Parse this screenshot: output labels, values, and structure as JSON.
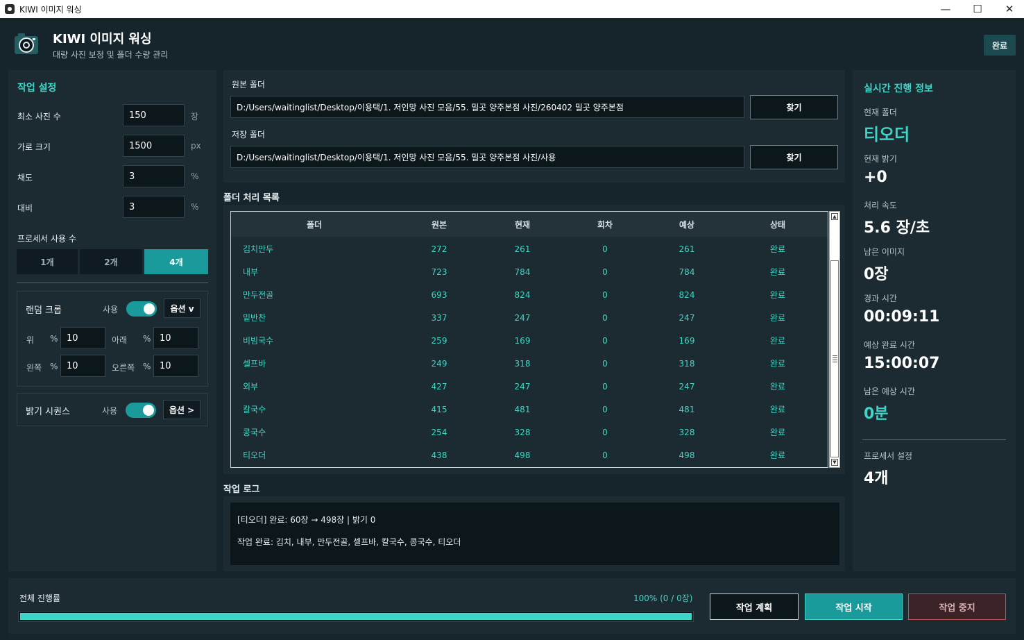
{
  "window": {
    "title": "KIWI 이미지 워싱",
    "controls": {
      "minimize": "—",
      "maximize": "☐",
      "close": "✕"
    }
  },
  "header": {
    "title": "KIWI 이미지 워싱",
    "subtitle": "대량 사진 보정 및 폴더 수량 관리",
    "status": "완료"
  },
  "settings": {
    "title": "작업 설정",
    "min_photos": {
      "label": "최소 사진 수",
      "value": "150",
      "unit": "장"
    },
    "width": {
      "label": "가로 크기",
      "value": "1500",
      "unit": "px"
    },
    "saturation": {
      "label": "채도",
      "value": "3",
      "unit": "%"
    },
    "contrast": {
      "label": "대비",
      "value": "3",
      "unit": "%"
    },
    "processors": {
      "label": "프로세서 사용 수",
      "options": [
        "1개",
        "2개",
        "4개"
      ],
      "selected": "4개"
    },
    "random_crop": {
      "label": "랜덤 크롭",
      "use_label": "사용",
      "enabled": true,
      "option_label": "옵션 v",
      "top": {
        "label": "위",
        "unit": "%",
        "value": "10"
      },
      "bottom": {
        "label": "아래",
        "unit": "%",
        "value": "10"
      },
      "left": {
        "label": "왼쪽",
        "unit": "%",
        "value": "10"
      },
      "right": {
        "label": "오른쪽",
        "unit": "%",
        "value": "10"
      }
    },
    "brightness_sequence": {
      "label": "밝기 시퀀스",
      "use_label": "사용",
      "enabled": true,
      "option_label": "옵션 >"
    }
  },
  "folders": {
    "source": {
      "label": "원본 폴더",
      "value": "D:/Users/waitinglist/Desktop/이용택/1. 저인망 사진 모음/55. 밀곳 양주본점 사진/260402 밀곳 양주본점",
      "button": "찾기"
    },
    "output": {
      "label": "저장 폴더",
      "value": "D:/Users/waitinglist/Desktop/이용택/1. 저인망 사진 모음/55. 밀곳 양주본점 사진/사용",
      "button": "찾기"
    }
  },
  "folder_list": {
    "title": "폴더 처리 목록",
    "columns": [
      "폴더",
      "원본",
      "현재",
      "회차",
      "예상",
      "상태"
    ],
    "rows": [
      {
        "folder": "김치만두",
        "original": "272",
        "current": "261",
        "round": "0",
        "expected": "261",
        "status": "완료"
      },
      {
        "folder": "내부",
        "original": "723",
        "current": "784",
        "round": "0",
        "expected": "784",
        "status": "완료"
      },
      {
        "folder": "만두전골",
        "original": "693",
        "current": "824",
        "round": "0",
        "expected": "824",
        "status": "완료"
      },
      {
        "folder": "밑반찬",
        "original": "337",
        "current": "247",
        "round": "0",
        "expected": "247",
        "status": "완료"
      },
      {
        "folder": "비빔국수",
        "original": "259",
        "current": "169",
        "round": "0",
        "expected": "169",
        "status": "완료"
      },
      {
        "folder": "셀프바",
        "original": "249",
        "current": "318",
        "round": "0",
        "expected": "318",
        "status": "완료"
      },
      {
        "folder": "외부",
        "original": "427",
        "current": "247",
        "round": "0",
        "expected": "247",
        "status": "완료"
      },
      {
        "folder": "칼국수",
        "original": "415",
        "current": "481",
        "round": "0",
        "expected": "481",
        "status": "완료"
      },
      {
        "folder": "콩국수",
        "original": "254",
        "current": "328",
        "round": "0",
        "expected": "328",
        "status": "완료"
      },
      {
        "folder": "티오더",
        "original": "438",
        "current": "498",
        "round": "0",
        "expected": "498",
        "status": "완료"
      }
    ]
  },
  "log": {
    "title": "작업 로그",
    "lines": [
      "[티오더] 완료: 60장 → 498장 | 밝기 0",
      "",
      "작업 완료: 김치, 내부, 만두전골, 셀프바, 칼국수, 콩국수, 티오더"
    ]
  },
  "live_info": {
    "title": "실시간 진행 정보",
    "current_folder": {
      "label": "현재 폴더",
      "value": "티오더"
    },
    "current_brightness": {
      "label": "현재 밝기",
      "value": "+0"
    },
    "speed": {
      "label": "처리 속도",
      "value": "5.6 장/초"
    },
    "remaining_images": {
      "label": "남은 이미지",
      "value": "0장"
    },
    "elapsed": {
      "label": "경과 시간",
      "value": "00:09:11"
    },
    "eta": {
      "label": "예상 완료 시간",
      "value": "15:00:07"
    },
    "remaining_time": {
      "label": "남은 예상 시간",
      "value": "0분"
    },
    "processor_setting": {
      "label": "프로세서 설정",
      "value": "4개"
    }
  },
  "footer": {
    "progress_label": "전체 진행률",
    "progress_text": "100%  (0 / 0장)",
    "progress_fraction": 1.0,
    "plan_button": "작업 계획",
    "start_button": "작업 시작",
    "stop_button": "작업 중지"
  },
  "colors": {
    "accent": "#3fd4c8",
    "accent_dark": "#1a9a9a",
    "background": "#16252b",
    "panel": "#1c2b31",
    "stop": "#c05050"
  }
}
